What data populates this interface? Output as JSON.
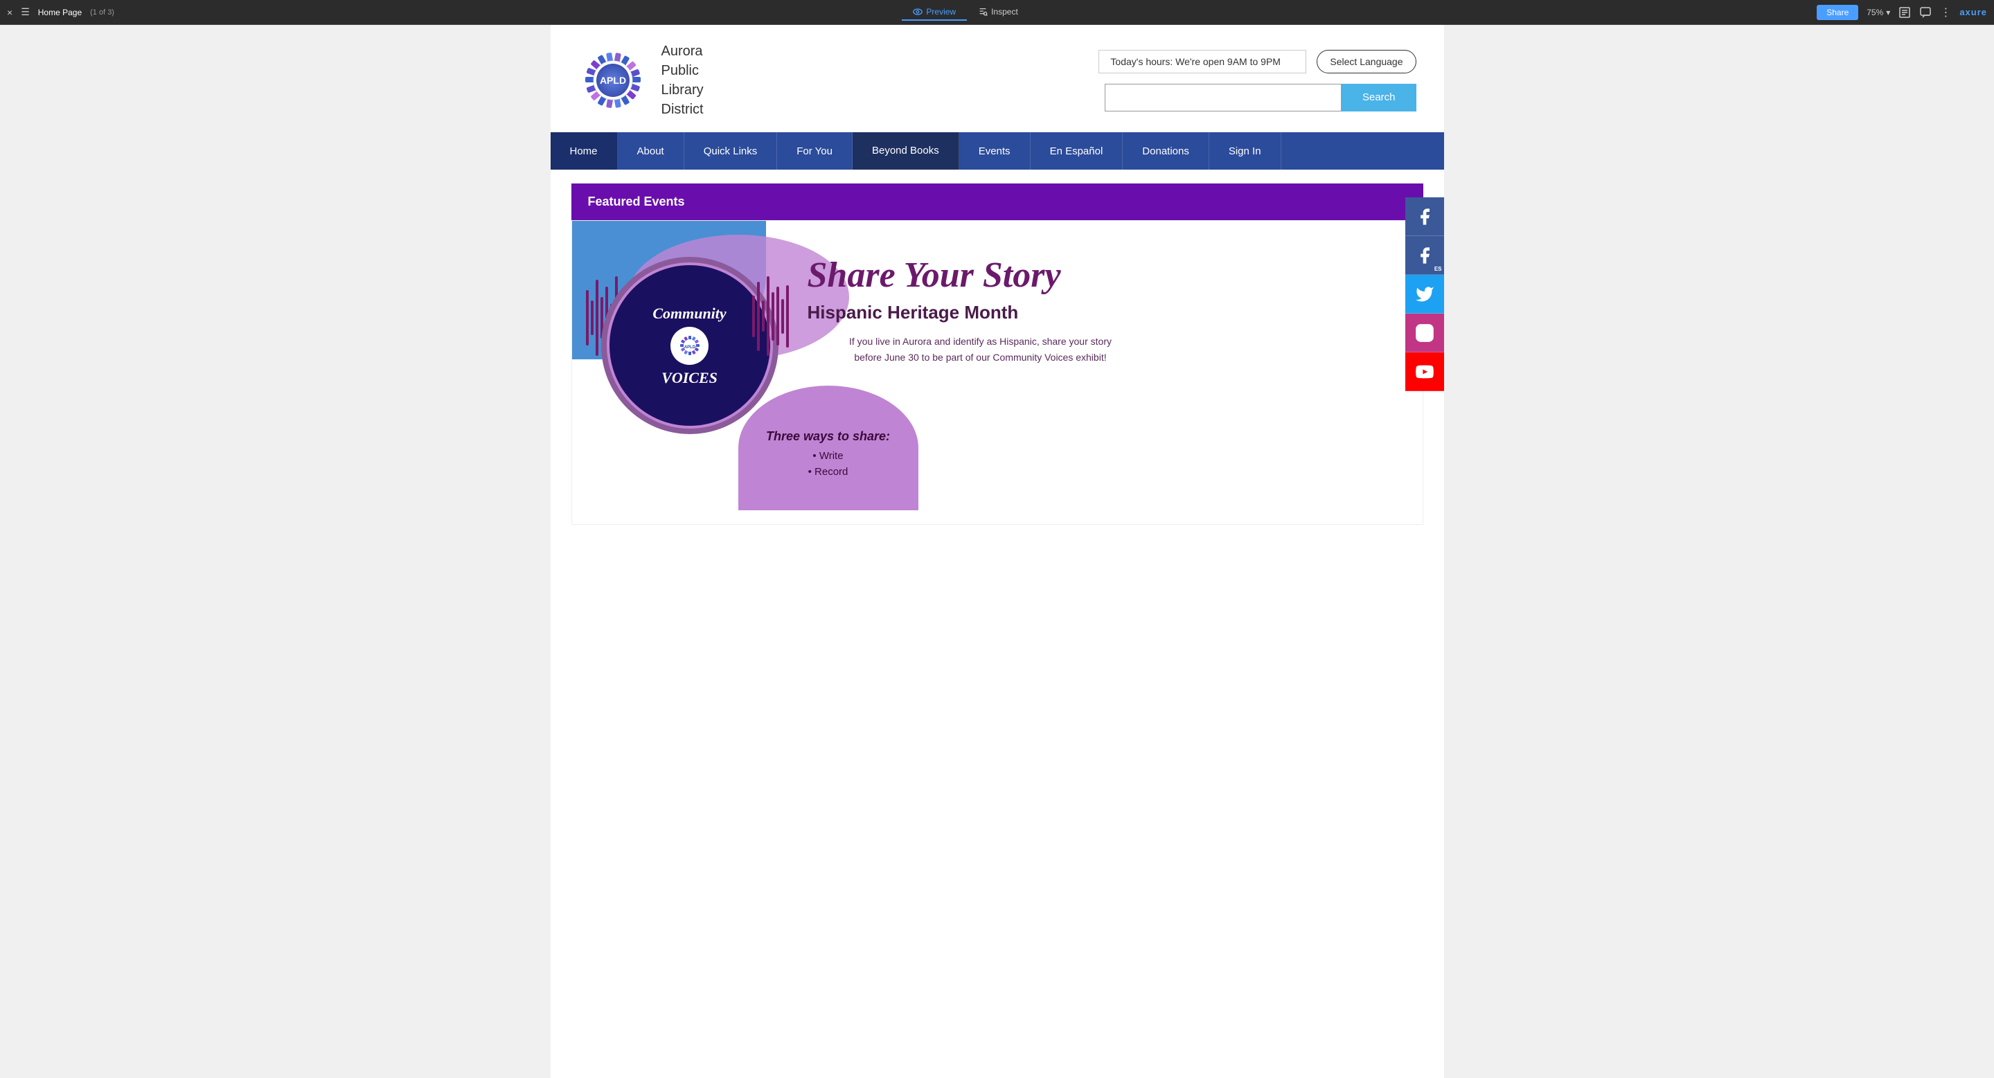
{
  "toolbar": {
    "close": "×",
    "menu_icon": "☰",
    "page_title": "Home Page",
    "page_num": "(1 of 3)",
    "preview_label": "Preview",
    "inspect_label": "Inspect",
    "share_label": "Share",
    "zoom": "75%",
    "axure_logo": "axure",
    "dots": "⋮"
  },
  "header": {
    "logo_text_1": "Aurora",
    "logo_text_2": "Public",
    "logo_text_3": "Library",
    "logo_text_4": "District",
    "logo_abbr": "APLD",
    "hours_text": "Today's hours: We're open 9AM to 9PM",
    "lang_btn": "Select Language",
    "search_placeholder": "",
    "search_btn": "Search"
  },
  "navbar": {
    "items": [
      {
        "label": "Home",
        "active": true
      },
      {
        "label": "About"
      },
      {
        "label": "Quick Links"
      },
      {
        "label": "For You"
      },
      {
        "label": "Beyond Books",
        "dark": true
      },
      {
        "label": "Events"
      },
      {
        "label": "En Español"
      },
      {
        "label": "Donations"
      },
      {
        "label": "Sign In"
      }
    ]
  },
  "featured_events": {
    "banner_title": "Featured Events",
    "card": {
      "title": "Share Your Story",
      "subtitle": "Hispanic Heritage Month",
      "description": "If you live in Aurora and identify as Hispanic, share your story\nbefore June 30 to be part of our Community Voices exhibit!",
      "circle_top": "Community",
      "circle_bottom": "VOICES",
      "circle_center": "APLD",
      "three_ways_title": "Three ways to share:",
      "three_ways_items": [
        "• Write",
        "• Record"
      ]
    }
  },
  "social": {
    "buttons": [
      {
        "name": "facebook",
        "label": "f"
      },
      {
        "name": "facebook-es",
        "label": "f"
      },
      {
        "name": "twitter",
        "label": "t"
      },
      {
        "name": "instagram",
        "label": "i"
      },
      {
        "name": "youtube",
        "label": "▶"
      }
    ]
  }
}
